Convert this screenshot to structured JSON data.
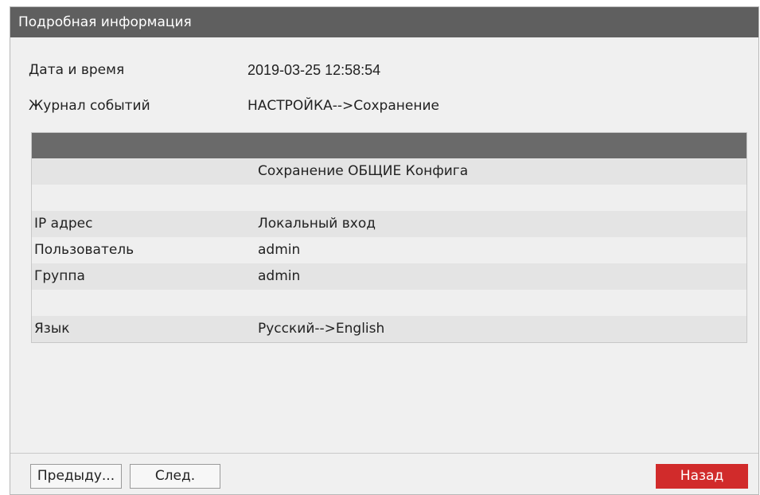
{
  "window": {
    "title": "Подробная информация"
  },
  "info": {
    "datetime_label": "Дата и время",
    "datetime_value": "2019-03-25 12:58:54",
    "event_log_label": "Журнал событий",
    "event_log_value": "НАСТРОЙКА-->Сохранение"
  },
  "details": {
    "rows": [
      {
        "label": "",
        "value": "Сохранение ОБЩИЕ Конфига"
      },
      {
        "label": "",
        "value": ""
      },
      {
        "label": "IP адрес",
        "value": "Локальный вход"
      },
      {
        "label": "Пользователь",
        "value": "admin"
      },
      {
        "label": "Группа",
        "value": "admin"
      },
      {
        "label": "",
        "value": ""
      },
      {
        "label": "Язык",
        "value": "Русский-->English"
      }
    ]
  },
  "buttons": {
    "prev_label": "Предыду...",
    "next_label": "След.",
    "back_label": "Назад"
  },
  "colors": {
    "title_bar": "#5f5f5f",
    "back_button": "#d12b2b"
  }
}
